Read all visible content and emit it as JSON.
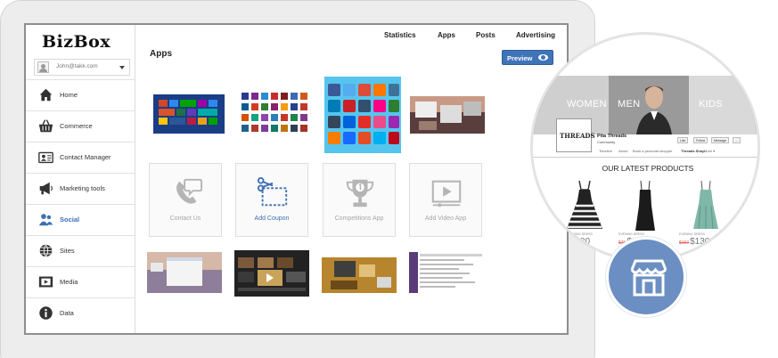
{
  "app": {
    "logo": "BizBox"
  },
  "user": {
    "email": "John@takk.com"
  },
  "sidebar": {
    "items": [
      {
        "label": "Home",
        "icon": "home-icon"
      },
      {
        "label": "Commerce",
        "icon": "basket-icon"
      },
      {
        "label": "Contact Manager",
        "icon": "contact-card-icon"
      },
      {
        "label": "Marketing tools",
        "icon": "megaphone-icon"
      },
      {
        "label": "Social",
        "icon": "users-icon",
        "active": true
      },
      {
        "label": "Sites",
        "icon": "globe-icon"
      },
      {
        "label": "Media",
        "icon": "video-icon"
      },
      {
        "label": "Data",
        "icon": "info-icon"
      }
    ]
  },
  "topnav": {
    "items": [
      "Statistics",
      "Apps",
      "Posts",
      "Advertising"
    ]
  },
  "main": {
    "title": "Apps",
    "preview_label": "Preview",
    "tiles": [
      {
        "label": "Contact Us",
        "icon": "phone-chat-icon"
      },
      {
        "label": "Add Coupon",
        "icon": "scissors-coupon-icon"
      },
      {
        "label": "Competitions App",
        "icon": "trophy-icon"
      },
      {
        "label": "Add Video App",
        "icon": "video-play-icon"
      }
    ]
  },
  "store_preview": {
    "banner_words": [
      "WOMEN",
      "MEN",
      "KIDS"
    ],
    "brand_logo": "THREADS",
    "page_name": "Pita Threads",
    "page_category": "Community",
    "buttons": [
      "Like",
      "Follow",
      "Message",
      "..."
    ],
    "tabs": [
      "Timeline",
      "About",
      "Book a personal shopper",
      "Threads Shop",
      "More ▾"
    ],
    "products_heading": "OUR LATEST PRODUCTS",
    "products": [
      {
        "label": "EVENING DRESS",
        "old_price": "$90",
        "price": "$80",
        "swatches": [
          "#c94040",
          "#3b3b3b",
          "#e6c0c0"
        ]
      },
      {
        "label": "EVENING DRESS",
        "old_price": "$75",
        "price": "$60",
        "swatches": [
          "#c94040",
          "#3b3b3b"
        ]
      },
      {
        "label": "EVENING DRESS",
        "old_price": "$150",
        "price": "$130",
        "swatches": [
          "#c94040",
          "#3b3b3b",
          "#7fb8a8"
        ]
      }
    ]
  },
  "colors": {
    "accent": "#3f74b8",
    "badge": "#6b8fc2",
    "active_nav": "#3e6fb3"
  }
}
